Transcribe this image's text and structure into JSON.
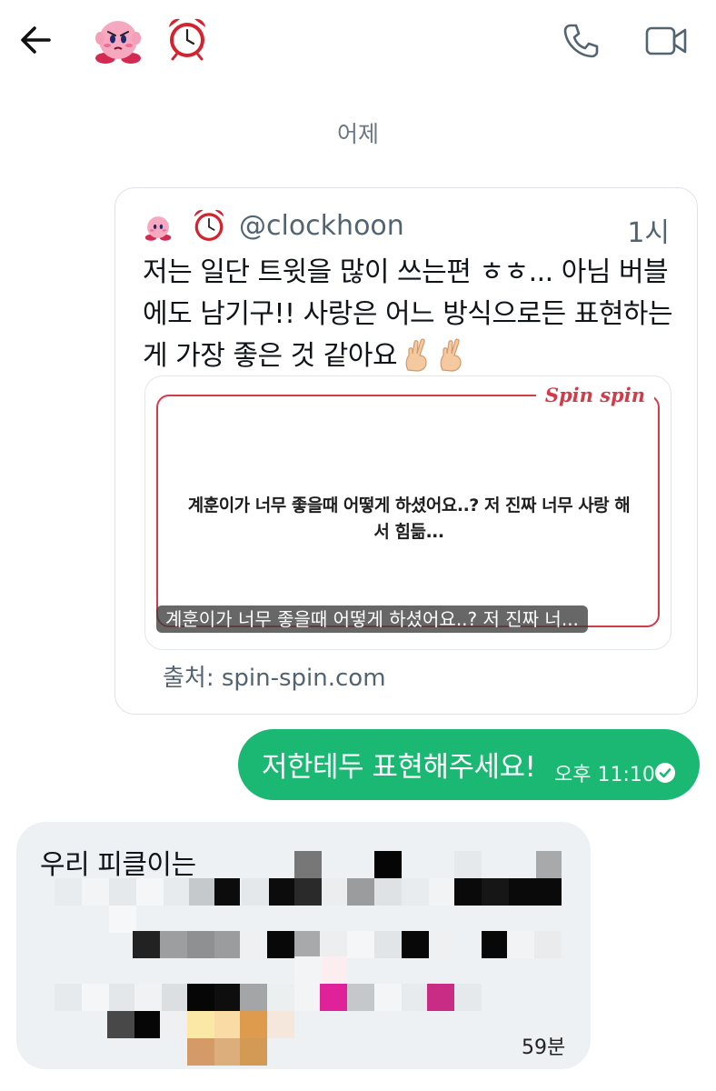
{
  "header": {
    "back_icon": "arrow-left-icon",
    "avatar_icons": [
      "kirby-emoji-icon",
      "alarm-clock-emoji-icon"
    ],
    "call_icon": "phone-icon",
    "video_icon": "video-camera-icon"
  },
  "date_separator": "어제",
  "quote_tweet": {
    "handle": "@clockhoon",
    "time": "1시",
    "text": "저는 일단 트윗을 많이 쓰는편 ㅎㅎ... 아님 버블에도 남기구!! 사랑은 어느 방식으로든 표현하는게 가장 좋은 것 같아요",
    "emoji_icons": [
      "crossed-fingers-icon",
      "crossed-fingers-icon"
    ],
    "media": {
      "logo": "Spin spin",
      "question": "계훈이가 너무 좋을때 어떻게 하셨어요..? 저 진짜 너무 사랑 해서 힘듦...",
      "caption": "계훈이가 너무 좋을때 어떻게 하셨어요..? 저 진짜 너..."
    },
    "source": "출처: spin-spin.com"
  },
  "sent_message": {
    "text": "저한테두 표현해주세요!",
    "time": "오후 11:10",
    "status_icon": "read-check-icon"
  },
  "received_message": {
    "text": "우리 피클이는",
    "time": "59분"
  },
  "colors": {
    "sent_bubble": "#1bb873",
    "received_bubble": "#eef1f3",
    "spin_accent": "#d23c49"
  }
}
